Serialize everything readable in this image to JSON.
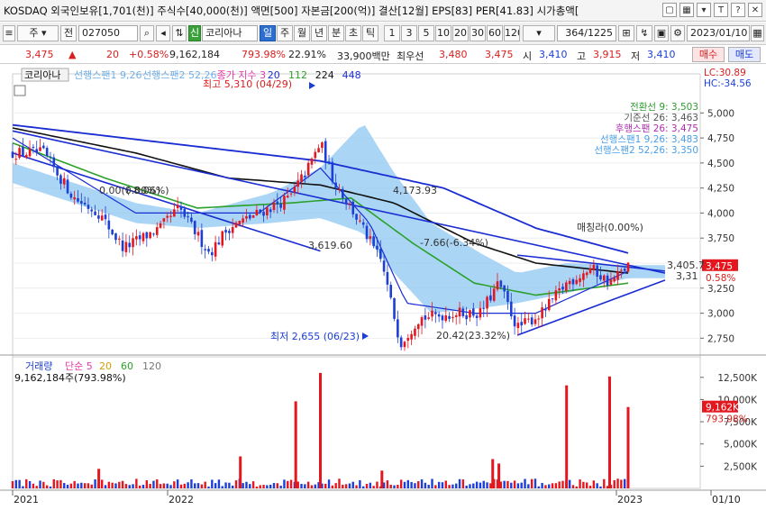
{
  "title_bar": {
    "text": "KOSDAQ 외국인보유[1,701(천)] 주식수[40,000(천)] 액면[500] 자본금[200(억)] 결산[12월] EPS[83] PER[41.83] 시가총액[",
    "icons": [
      "window-icon",
      "grid-icon",
      "settings-icon",
      "text-size-icon",
      "help-icon",
      "close-icon"
    ]
  },
  "toolbar": {
    "mode_label": "주",
    "jeon_label": "전",
    "code": "027050",
    "market_badge": "신",
    "stock_name": "코리아나",
    "periods": [
      "일",
      "주",
      "월",
      "년",
      "분",
      "초",
      "틱"
    ],
    "active_period": "일",
    "intervals": [
      "1",
      "3",
      "5",
      "10",
      "20",
      "30",
      "60",
      "120"
    ],
    "count_current": "364",
    "count_total": "/1225",
    "date": "2023/01/10"
  },
  "quote": {
    "price": "3,475",
    "change": "20",
    "change_pct": "+0.58%",
    "volume": "9,162,184",
    "volume_ratio": "793.98%",
    "turnover": "22.91%",
    "amount": "33,900백만",
    "ask_label": "최우선",
    "ask1": "3,480",
    "ask2": "3,475",
    "open_label": "시",
    "open": "3,410",
    "high_label": "고",
    "high": "3,915",
    "low_label": "저",
    "low": "3,410",
    "buy_label": "매수",
    "sell_label": "매도"
  },
  "colors": {
    "up": "#e4171f",
    "down": "#1c3fd6",
    "ma5": "#e53aa8",
    "ma20": "#1a2dd2",
    "ma60": "#2aa12a",
    "ma112": "#111111",
    "ma224": "#1a2dd2",
    "cloud": "#8fc7f2",
    "ichi_conv": "#2f9b2f",
    "ichi_base": "#555555",
    "ichi_lag": "#b02eb0",
    "ichi_lead1": "#4aa0e8",
    "ichi_lead2": "#4aa0e8"
  },
  "chart_data": [
    {
      "type": "candlestick",
      "title": "코리아나",
      "legend": [
        {
          "name": "선행스팬1 9,26",
          "color": "#6fb0ea"
        },
        {
          "name": "선행스팬2 52,26",
          "color": "#6fb0ea"
        },
        {
          "name": "종가 지수 3",
          "color": "#e53aa8"
        },
        {
          "name": "20",
          "color": "#1a2dd2"
        },
        {
          "name": "112",
          "color": "#2aa12a"
        },
        {
          "name": "224",
          "color": "#111111"
        },
        {
          "name": "448",
          "color": "#1a2dd2"
        }
      ],
      "ylim": [
        2600,
        5300
      ],
      "yticks": [
        2750,
        3000,
        3250,
        3500,
        3750,
        4000,
        4250,
        4500,
        4750,
        5000
      ],
      "ytick_labels": [
        "2,750",
        "3,000",
        "3,250",
        "3,500",
        "3,750",
        "4,000",
        "4,250",
        "4,500",
        "4,750",
        "5,000"
      ],
      "x_labels": [
        "2021",
        "2022",
        "2023",
        "01/10"
      ],
      "top_right": [
        "LC:30.89",
        "HC:-34.56"
      ],
      "last_price_label": "3,475",
      "last_pct_label": "0.58%",
      "ichimoku_labels": [
        "전환선 9: 3,503",
        "기준선 26: 3,463",
        "후행스팬 26: 3,475",
        "선행스팬1 9,26: 3,483",
        "선행스팬2 52,26: 3,350"
      ],
      "annotations": [
        {
          "text": "최고 5,310 (04/29)",
          "color": "#d81e1e"
        },
        {
          "text": "최저 2,655 (06/23)",
          "color": "#1c3fd6"
        },
        {
          "text": "0.00(0.00%)",
          "color": "#333"
        },
        {
          "text": "(-8.06%)",
          "color": "#333"
        },
        {
          "text": "4,173.93",
          "color": "#333"
        },
        {
          "text": "3,619.60",
          "color": "#333"
        },
        {
          "text": "-7.66(-6.34%)",
          "color": "#333"
        },
        {
          "text": "20.42(23.32%)",
          "color": "#333"
        },
        {
          "text": "매칭라(0.00%)",
          "color": "#333"
        },
        {
          "text": "3,405.7",
          "color": "#333"
        },
        {
          "text": "3,31",
          "color": "#333"
        }
      ],
      "anchor_points": [
        {
          "t": 0,
          "p": 4600
        },
        {
          "t": 0.05,
          "p": 4600
        },
        {
          "t": 0.1,
          "p": 4150
        },
        {
          "t": 0.14,
          "p": 4000
        },
        {
          "t": 0.18,
          "p": 3650
        },
        {
          "t": 0.24,
          "p": 3850
        },
        {
          "t": 0.27,
          "p": 4050
        },
        {
          "t": 0.32,
          "p": 3600
        },
        {
          "t": 0.35,
          "p": 3850
        },
        {
          "t": 0.4,
          "p": 4000
        },
        {
          "t": 0.45,
          "p": 4150
        },
        {
          "t": 0.48,
          "p": 4450
        },
        {
          "t": 0.5,
          "p": 4700
        },
        {
          "t": 0.52,
          "p": 4350
        },
        {
          "t": 0.55,
          "p": 4050
        },
        {
          "t": 0.6,
          "p": 3500
        },
        {
          "t": 0.63,
          "p": 2700
        },
        {
          "t": 0.66,
          "p": 2950
        },
        {
          "t": 0.72,
          "p": 3000
        },
        {
          "t": 0.76,
          "p": 3000
        },
        {
          "t": 0.79,
          "p": 3300
        },
        {
          "t": 0.82,
          "p": 2850
        },
        {
          "t": 0.86,
          "p": 3000
        },
        {
          "t": 0.9,
          "p": 3300
        },
        {
          "t": 0.94,
          "p": 3450
        },
        {
          "t": 0.97,
          "p": 3300
        },
        {
          "t": 1,
          "p": 3475
        }
      ],
      "ma_anchors": {
        "ma20": [
          {
            "t": 0,
            "p": 4750
          },
          {
            "t": 0.2,
            "p": 4000
          },
          {
            "t": 0.4,
            "p": 4000
          },
          {
            "t": 0.5,
            "p": 4450
          },
          {
            "t": 0.58,
            "p": 3900
          },
          {
            "t": 0.64,
            "p": 3100
          },
          {
            "t": 0.75,
            "p": 3000
          },
          {
            "t": 0.85,
            "p": 3000
          },
          {
            "t": 1,
            "p": 3420
          }
        ],
        "ma60": [
          {
            "t": 0,
            "p": 4700
          },
          {
            "t": 0.15,
            "p": 4350
          },
          {
            "t": 0.3,
            "p": 4050
          },
          {
            "t": 0.45,
            "p": 4100
          },
          {
            "t": 0.55,
            "p": 4150
          },
          {
            "t": 0.65,
            "p": 3700
          },
          {
            "t": 0.75,
            "p": 3300
          },
          {
            "t": 0.85,
            "p": 3180
          },
          {
            "t": 1,
            "p": 3300
          }
        ],
        "ma112": [
          {
            "t": 0,
            "p": 4850
          },
          {
            "t": 0.2,
            "p": 4600
          },
          {
            "t": 0.35,
            "p": 4350
          },
          {
            "t": 0.5,
            "p": 4280
          },
          {
            "t": 0.62,
            "p": 4100
          },
          {
            "t": 0.75,
            "p": 3700
          },
          {
            "t": 0.85,
            "p": 3500
          },
          {
            "t": 1,
            "p": 3400
          }
        ],
        "ma448": [
          {
            "t": 0,
            "p": 4880
          },
          {
            "t": 0.25,
            "p": 4700
          },
          {
            "t": 0.5,
            "p": 4520
          },
          {
            "t": 0.7,
            "p": 4250
          },
          {
            "t": 0.85,
            "p": 3850
          },
          {
            "t": 1,
            "p": 3600
          }
        ],
        "cloud_top": [
          {
            "t": 0,
            "p": 4500
          },
          {
            "t": 0.2,
            "p": 4100
          },
          {
            "t": 0.3,
            "p": 4000
          },
          {
            "t": 0.42,
            "p": 4200
          },
          {
            "t": 0.5,
            "p": 4450
          },
          {
            "t": 0.57,
            "p": 4900
          },
          {
            "t": 0.62,
            "p": 4400
          },
          {
            "t": 0.68,
            "p": 3900
          },
          {
            "t": 0.76,
            "p": 3600
          },
          {
            "t": 0.82,
            "p": 3400
          },
          {
            "t": 0.9,
            "p": 3500
          },
          {
            "t": 1,
            "p": 3480
          }
        ],
        "cloud_bottom": [
          {
            "t": 0,
            "p": 4300
          },
          {
            "t": 0.2,
            "p": 3900
          },
          {
            "t": 0.3,
            "p": 3850
          },
          {
            "t": 0.42,
            "p": 3900
          },
          {
            "t": 0.5,
            "p": 3950
          },
          {
            "t": 0.57,
            "p": 3800
          },
          {
            "t": 0.62,
            "p": 3400
          },
          {
            "t": 0.68,
            "p": 3000
          },
          {
            "t": 0.76,
            "p": 3050
          },
          {
            "t": 0.82,
            "p": 3100
          },
          {
            "t": 0.9,
            "p": 3200
          },
          {
            "t": 1,
            "p": 3350
          }
        ]
      },
      "trendlines": [
        {
          "name": "downtrend-upper",
          "from": {
            "t": 0,
            "p": 4820
          },
          "to": {
            "t": 1.06,
            "p": 3400
          },
          "color": "#1a2dd2"
        },
        {
          "name": "downtrend-lower",
          "from": {
            "t": 0,
            "p": 4600
          },
          "to": {
            "t": 0.5,
            "p": 3620
          },
          "color": "#1a2dd2"
        },
        {
          "name": "resistance",
          "from": {
            "t": 0.82,
            "p": 3580
          },
          "to": {
            "t": 1.06,
            "p": 3420
          },
          "color": "#1a2dd2"
        },
        {
          "name": "support",
          "from": {
            "t": 0.82,
            "p": 2780
          },
          "to": {
            "t": 1.06,
            "p": 3330
          },
          "color": "#1a2dd2"
        }
      ]
    },
    {
      "type": "bar",
      "title": "거래량",
      "legend": [
        {
          "name": "단순 5",
          "color": "#e53aa8"
        },
        {
          "name": "20",
          "color": "#d6a000"
        },
        {
          "name": "60",
          "color": "#2aa12a"
        },
        {
          "name": "120",
          "color": "#777777"
        }
      ],
      "volume_text": "9,162,184주(793.98%)",
      "ylim": [
        0,
        14000
      ],
      "yticks": [
        2500,
        5000,
        7500,
        10000,
        12500
      ],
      "ytick_labels": [
        "2,500K",
        "5,000K",
        "7,500K",
        "10,000K",
        "12,500K"
      ],
      "last_label": "9,162K",
      "last_pct_label": "793.98%",
      "spikes": [
        {
          "t": 0.14,
          "v": 2200
        },
        {
          "t": 0.37,
          "v": 3600
        },
        {
          "t": 0.46,
          "v": 9800
        },
        {
          "t": 0.5,
          "v": 13000
        },
        {
          "t": 0.6,
          "v": 2000
        },
        {
          "t": 0.78,
          "v": 3300
        },
        {
          "t": 0.79,
          "v": 2800
        },
        {
          "t": 0.9,
          "v": 11600
        },
        {
          "t": 0.97,
          "v": 12600
        },
        {
          "t": 1,
          "v": 9162
        }
      ]
    }
  ]
}
